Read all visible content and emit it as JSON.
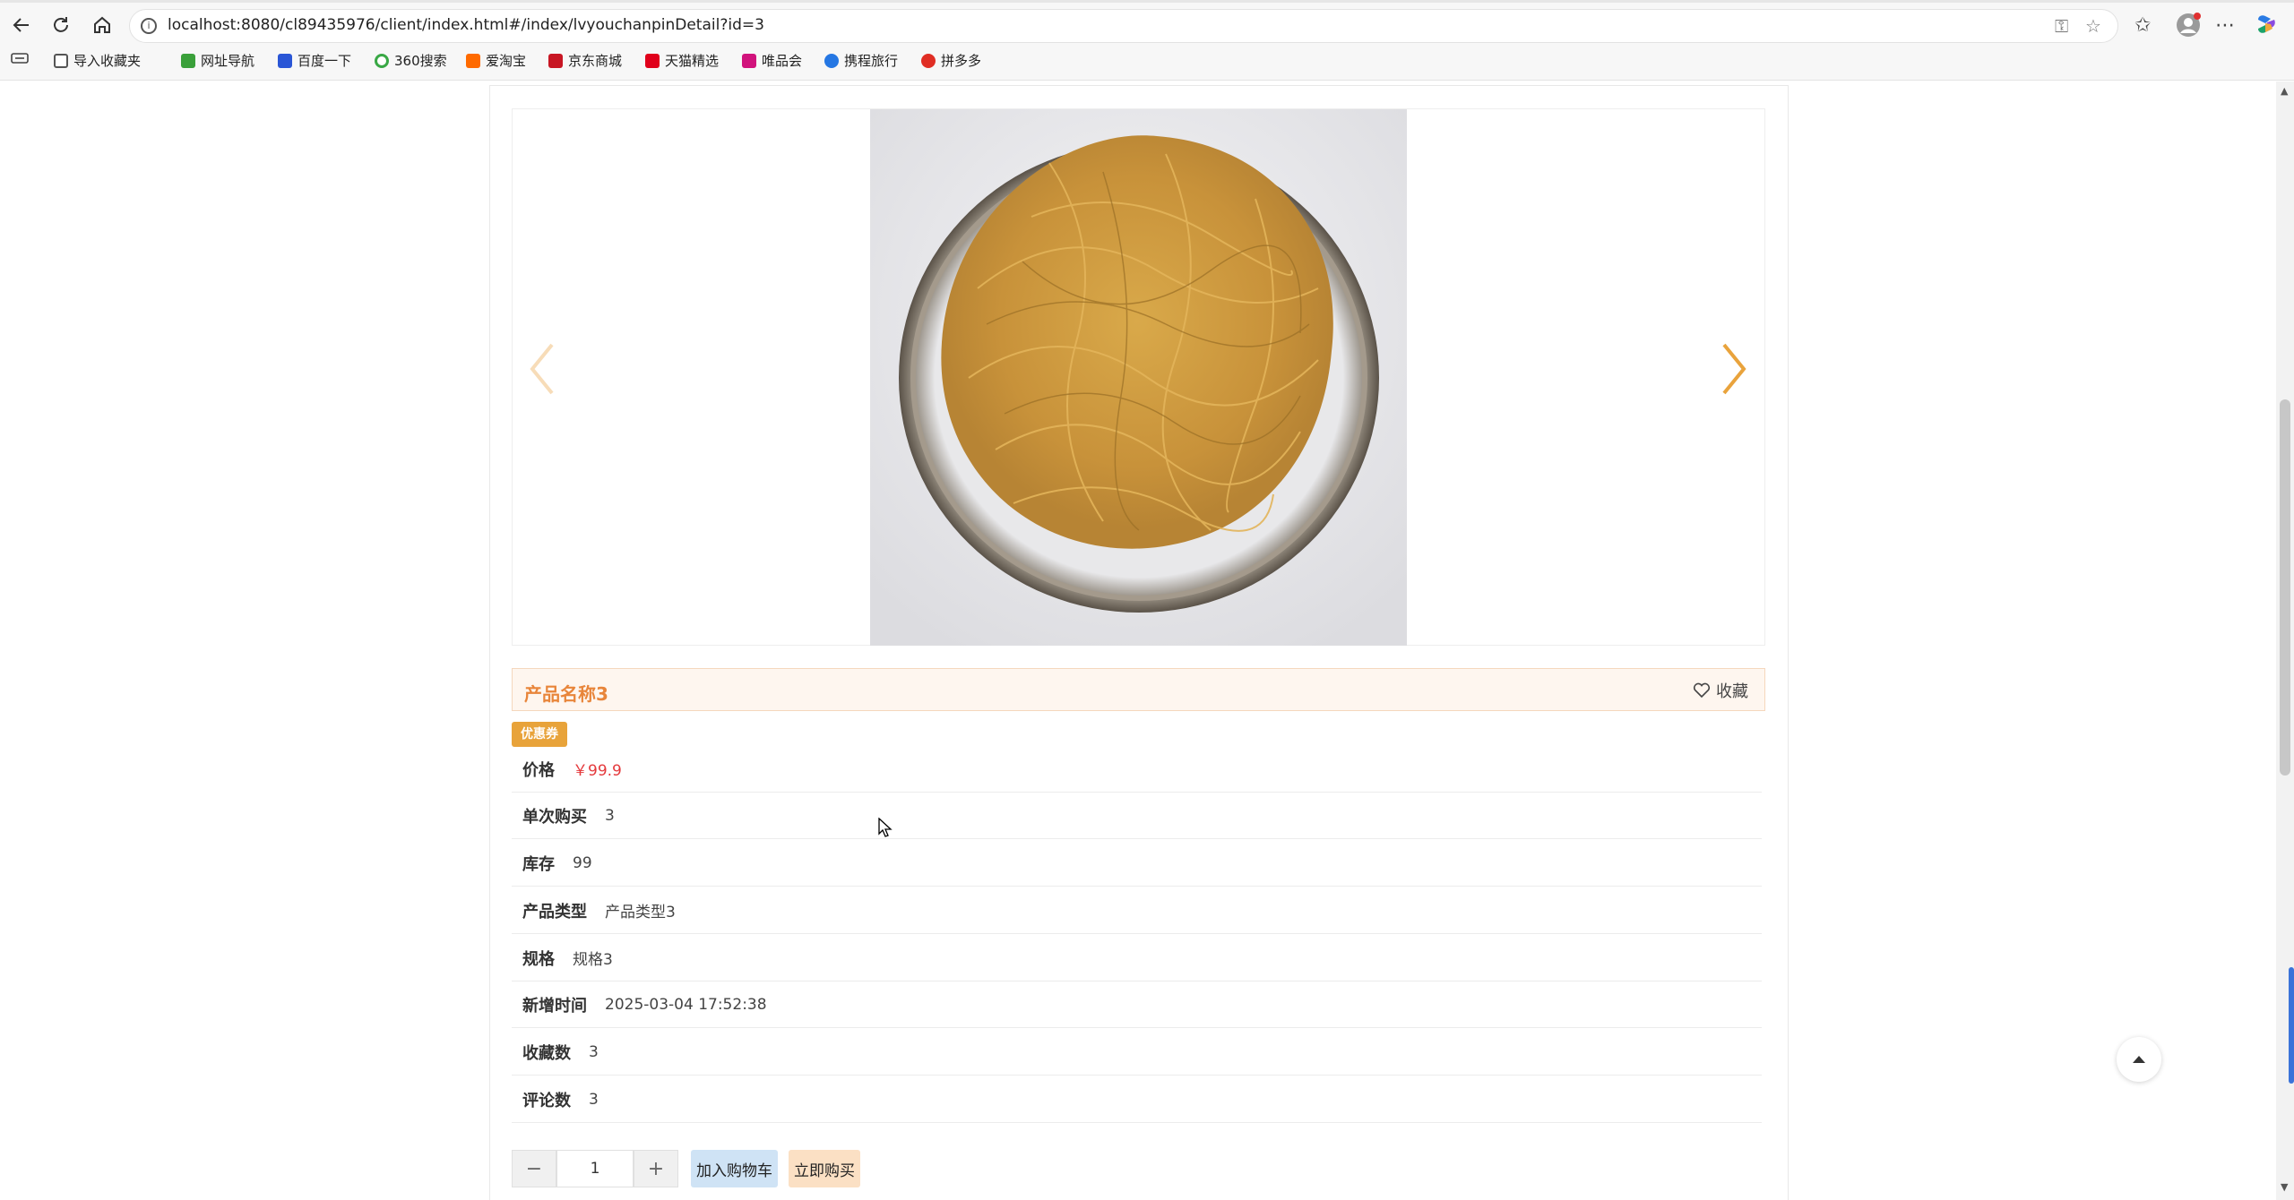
{
  "browser": {
    "url": "localhost:8080/cl89435976/client/index.html#/index/lvyouchanpinDetail?id=3",
    "bookmarks": [
      {
        "label": "导入收藏夹",
        "icon": "folder-icon",
        "color": "#555555"
      },
      {
        "label": "网址导航",
        "icon": "hao-icon",
        "color": "#3aa03a"
      },
      {
        "label": "百度一下",
        "icon": "baidu-icon",
        "color": "#2a56d6"
      },
      {
        "label": "360搜索",
        "icon": "360-icon",
        "color": "#39a845"
      },
      {
        "label": "爱淘宝",
        "icon": "taobao-icon",
        "color": "#ff6a00"
      },
      {
        "label": "京东商城",
        "icon": "jd-icon",
        "color": "#c81623"
      },
      {
        "label": "天猫精选",
        "icon": "tmall-icon",
        "color": "#e0001b"
      },
      {
        "label": "唯品会",
        "icon": "vip-icon",
        "color": "#d1137c"
      },
      {
        "label": "携程旅行",
        "icon": "ctrip-icon",
        "color": "#2577e3"
      },
      {
        "label": "拼多多",
        "icon": "pdd-icon",
        "color": "#e02e24"
      }
    ]
  },
  "product": {
    "title": "产品名称3",
    "favorite_label": "收藏",
    "coupon_label": "优惠券",
    "attributes": [
      {
        "key": "价格",
        "value": "￥99.9"
      },
      {
        "key": "单次购买",
        "value": "3"
      },
      {
        "key": "库存",
        "value": "99"
      },
      {
        "key": "产品类型",
        "value": "产品类型3"
      },
      {
        "key": "规格",
        "value": "规格3"
      },
      {
        "key": "新增时间",
        "value": "2025-03-04 17:52:38"
      },
      {
        "key": "收藏数",
        "value": "3"
      },
      {
        "key": "评论数",
        "value": "3"
      }
    ],
    "quantity": "1",
    "minus_label": "−",
    "plus_label": "+",
    "add_to_cart_label": "加入购物车",
    "buy_now_label": "立即购买"
  },
  "colors": {
    "accent": "#e8853a",
    "price": "#e4393c",
    "coupon": "#e8a33a"
  }
}
